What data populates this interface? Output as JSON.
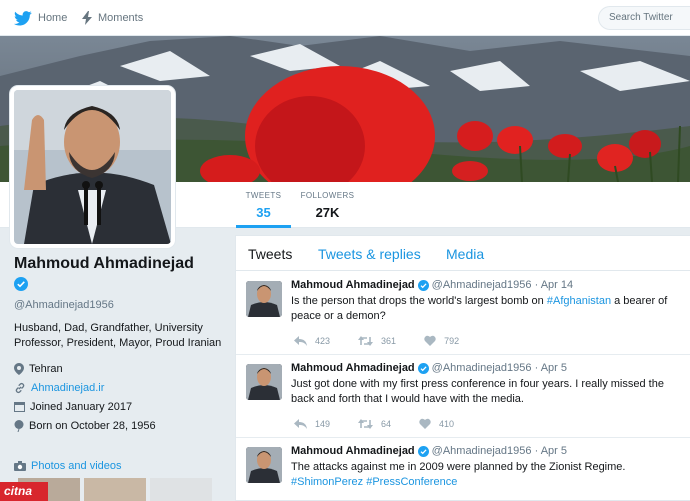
{
  "nav": {
    "home_label": "Home",
    "moments_label": "Moments",
    "search_placeholder": "Search Twitter"
  },
  "stats": {
    "tweets_label": "TWEETS",
    "tweets_value": "35",
    "followers_label": "FOLLOWERS",
    "followers_value": "27K"
  },
  "profile": {
    "name": "Mahmoud Ahmadinejad",
    "handle": "@Ahmadinejad1956",
    "bio": "Husband, Dad, Grandfather, University Professor, President, Mayor, Proud Iranian",
    "location": "Tehran",
    "website": "Ahmadinejad.ir",
    "joined": "Joined January 2017",
    "born": "Born on October 28, 1956",
    "photos_label": "Photos and videos"
  },
  "tabs": {
    "tweets": "Tweets",
    "replies": "Tweets & replies",
    "media": "Media"
  },
  "tweets": [
    {
      "name": "Mahmoud Ahmadinejad",
      "handle": "@Ahmadinejad1956",
      "date": "· Apr 14",
      "text_before": "Is the person that drops the world's largest bomb on ",
      "link": "#Afghanistan",
      "text_after": " a bearer of peace or a demon?",
      "replies": "423",
      "retweets": "361",
      "likes": "792"
    },
    {
      "name": "Mahmoud Ahmadinejad",
      "handle": "@Ahmadinejad1956",
      "date": "· Apr 5",
      "text": "Just got done with my first press conference in four years. I really missed the back and forth that I would have with the media.",
      "replies": "149",
      "retweets": "64",
      "likes": "410"
    },
    {
      "name": "Mahmoud Ahmadinejad",
      "handle": "@Ahmadinejad1956",
      "date": "· Apr 5",
      "text": "The attacks against me in 2009 were planned by the Zionist Regime.",
      "link1": "#ShimonPerez",
      "link2": "#PressConference"
    }
  ],
  "watermark": "citna",
  "colors": {
    "accent": "#1da1f2",
    "link": "#1b95e0",
    "background": "#e6ecf0"
  }
}
